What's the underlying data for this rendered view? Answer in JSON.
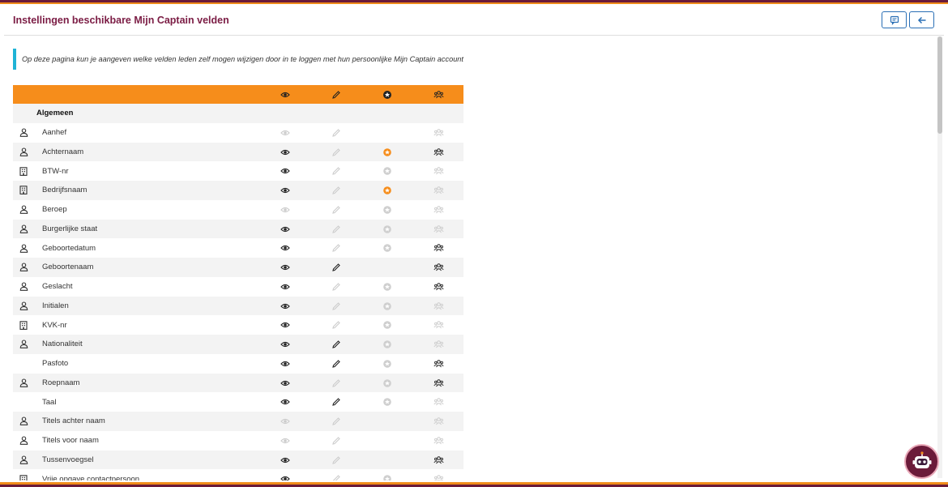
{
  "header": {
    "title": "Instellingen beschikbare Mijn Captain velden",
    "buttons": [
      {
        "icon": "comment-icon"
      },
      {
        "icon": "arrow-left-icon"
      }
    ]
  },
  "info": {
    "text": "Op deze pagina kun je aangeven welke velden leden zelf mogen wijzigen door in te loggen met hun persoonlijke Mijn Captain account"
  },
  "table": {
    "header_icons": [
      "eye-icon",
      "pencil-icon",
      "star-icon",
      "users-icon"
    ],
    "section": "Algemeen",
    "rows": [
      {
        "type": "person",
        "name": "Aanhef",
        "view": "off",
        "edit": "off",
        "star": "none",
        "group": "off"
      },
      {
        "type": "person",
        "name": "Achternaam",
        "view": "on",
        "edit": "off",
        "star": "orange",
        "group": "on"
      },
      {
        "type": "company",
        "name": "BTW-nr",
        "view": "on",
        "edit": "off",
        "star": "gray",
        "group": "off"
      },
      {
        "type": "company",
        "name": "Bedrijfsnaam",
        "view": "on",
        "edit": "off",
        "star": "orange",
        "group": "off"
      },
      {
        "type": "person",
        "name": "Beroep",
        "view": "off",
        "edit": "off",
        "star": "gray",
        "group": "off"
      },
      {
        "type": "person",
        "name": "Burgerlijke staat",
        "view": "on",
        "edit": "off",
        "star": "gray",
        "group": "off"
      },
      {
        "type": "person",
        "name": "Geboortedatum",
        "view": "on",
        "edit": "off",
        "star": "gray",
        "group": "on"
      },
      {
        "type": "person",
        "name": "Geboortenaam",
        "view": "on",
        "edit": "on",
        "star": "none",
        "group": "on"
      },
      {
        "type": "person",
        "name": "Geslacht",
        "view": "on",
        "edit": "off",
        "star": "gray",
        "group": "on"
      },
      {
        "type": "person",
        "name": "Initialen",
        "view": "on",
        "edit": "off",
        "star": "gray",
        "group": "off"
      },
      {
        "type": "company",
        "name": "KVK-nr",
        "view": "on",
        "edit": "off",
        "star": "gray",
        "group": "off"
      },
      {
        "type": "person",
        "name": "Nationaliteit",
        "view": "on",
        "edit": "on",
        "star": "gray",
        "group": "off"
      },
      {
        "type": "none",
        "name": "Pasfoto",
        "view": "on",
        "edit": "on",
        "star": "gray",
        "group": "on"
      },
      {
        "type": "person",
        "name": "Roepnaam",
        "view": "on",
        "edit": "off",
        "star": "gray",
        "group": "on"
      },
      {
        "type": "none",
        "name": "Taal",
        "view": "on",
        "edit": "on",
        "star": "gray",
        "group": "off"
      },
      {
        "type": "person",
        "name": "Titels achter naam",
        "view": "off",
        "edit": "off",
        "star": "none",
        "group": "off"
      },
      {
        "type": "person",
        "name": "Titels voor naam",
        "view": "off",
        "edit": "off",
        "star": "none",
        "group": "off"
      },
      {
        "type": "person",
        "name": "Tussenvoegsel",
        "view": "on",
        "edit": "off",
        "star": "none",
        "group": "on"
      },
      {
        "type": "company",
        "name": "Vrije opgave contactpersoon",
        "view": "on",
        "edit": "off",
        "star": "gray",
        "group": "off"
      }
    ]
  },
  "colors": {
    "brand": "#7b1c44",
    "accent": "#f68d1b",
    "info_bar": "#1fb3d6",
    "button_border": "#2a6fb5"
  }
}
